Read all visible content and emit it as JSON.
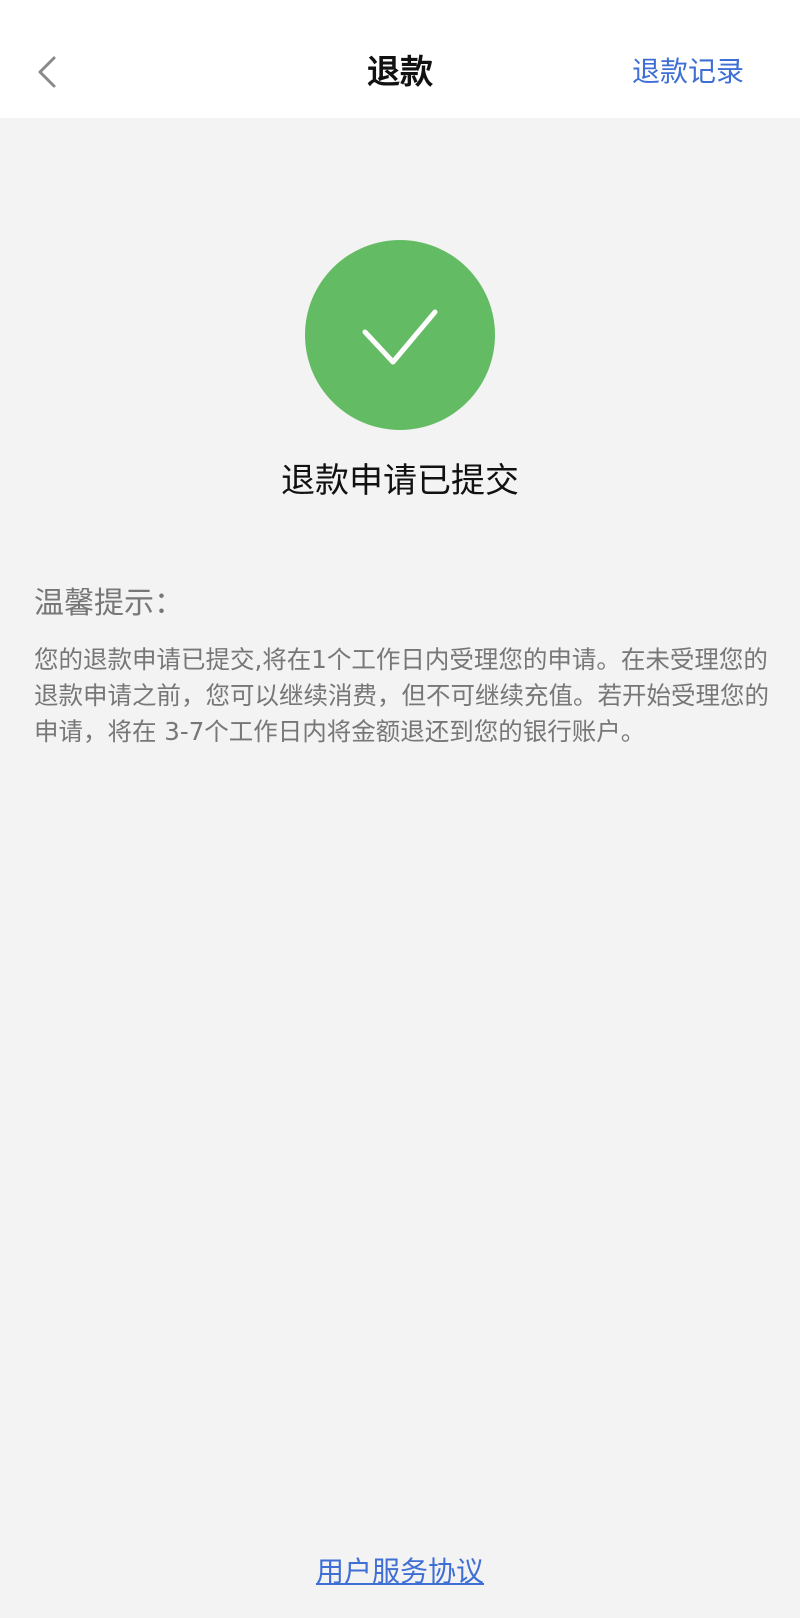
{
  "nav": {
    "title": "退款",
    "right_link": "退款记录"
  },
  "status": {
    "icon": "checkmark-icon",
    "color": "#63bc63",
    "text": "退款申请已提交"
  },
  "tips": {
    "title": "温馨提示：",
    "body": "您的退款申请已提交,将在1个工作日内受理您的申请。在未受理您的退款申请之前，您可以继续消费，但不可继续充值。若开始受理您的申请，将在 3-7个工作日内将金额退还到您的银行账户。"
  },
  "footer": {
    "agreement_link": "用户服务协议"
  },
  "colors": {
    "link": "#3f6fd4",
    "background": "#f3f3f3",
    "success": "#63bc63"
  }
}
